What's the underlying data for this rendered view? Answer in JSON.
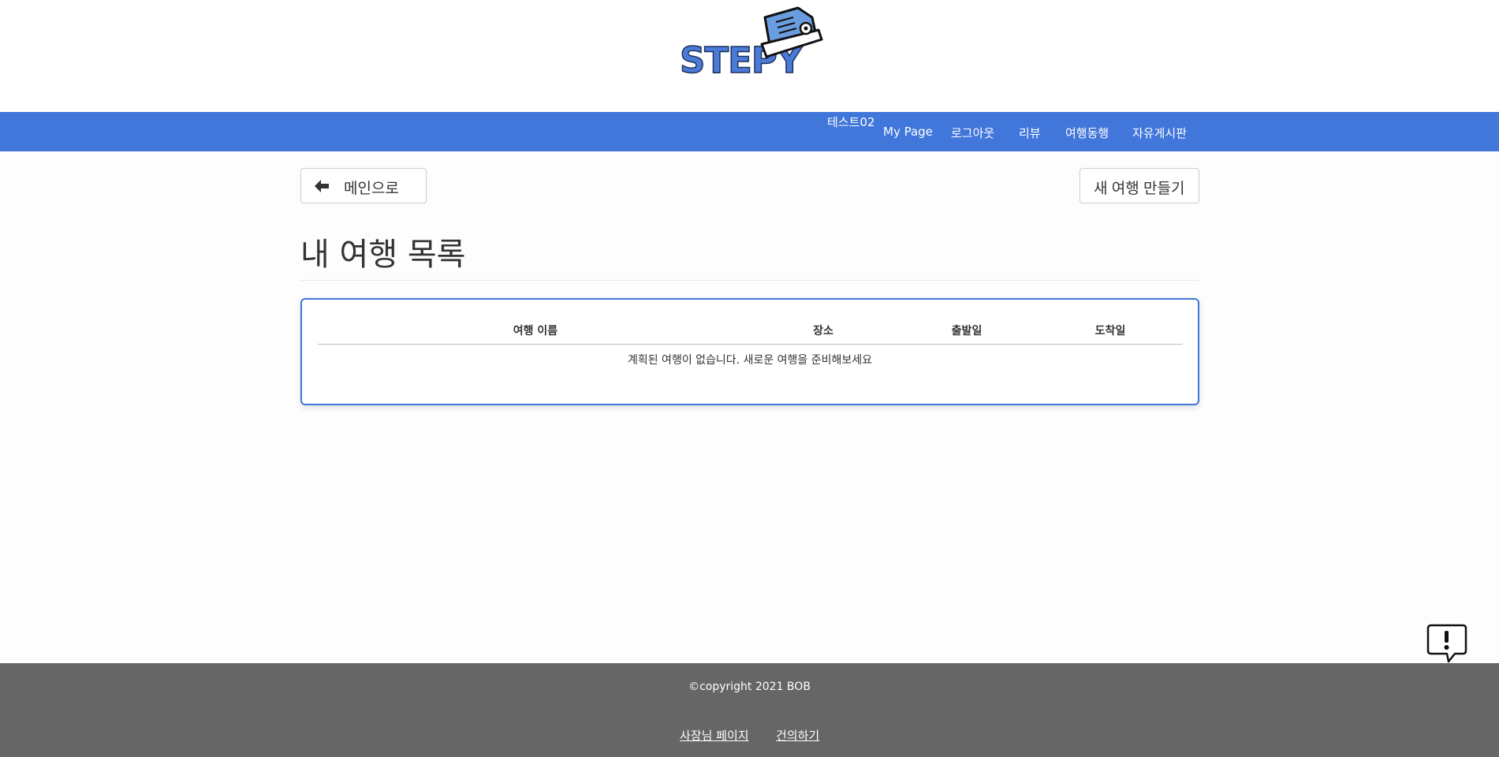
{
  "brand": {
    "logo_text": "STEPY"
  },
  "nav": {
    "user": "테스트02",
    "links": [
      "My Page",
      "로그아웃",
      "리뷰",
      "여행동행",
      "자유게시판"
    ]
  },
  "actions": {
    "back_label": "메인으로",
    "new_trip_label": "새 여행 만들기"
  },
  "page": {
    "title": "내 여행 목록"
  },
  "table": {
    "columns": [
      "여행 이름",
      "장소",
      "출발일",
      "도착일"
    ],
    "rows": [],
    "empty_message": "계획된 여행이 없습니다. 새로운 여행을 준비해보세요"
  },
  "footer": {
    "copyright": "©copyright 2021 BOB",
    "links": [
      "사장님 페이지",
      "건의하기"
    ]
  },
  "colors": {
    "accent": "#4176da",
    "footer_bg": "#666666"
  },
  "icons": {
    "back": "arrow-left-icon",
    "feedback": "exclamation-bubble-icon",
    "logo": "sneaker-icon"
  }
}
